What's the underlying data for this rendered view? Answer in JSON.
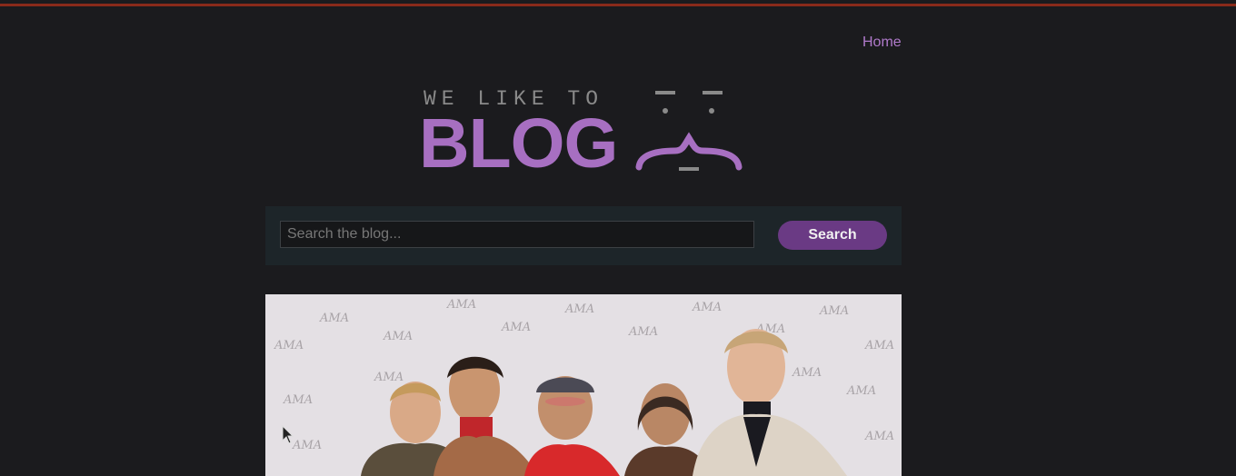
{
  "nav": {
    "home_label": "Home"
  },
  "logo": {
    "tagline": "WE LIKE TO",
    "word": "BLOG"
  },
  "search": {
    "placeholder": "Search the blog...",
    "value": "",
    "button_label": "Search"
  },
  "colors": {
    "background": "#1b1b1e",
    "accent": "#a76fc1",
    "button": "#6a3a84",
    "top_bar": "#8a2a1a",
    "search_panel": "#1d2529"
  },
  "hero": {
    "image": "group-photo"
  }
}
